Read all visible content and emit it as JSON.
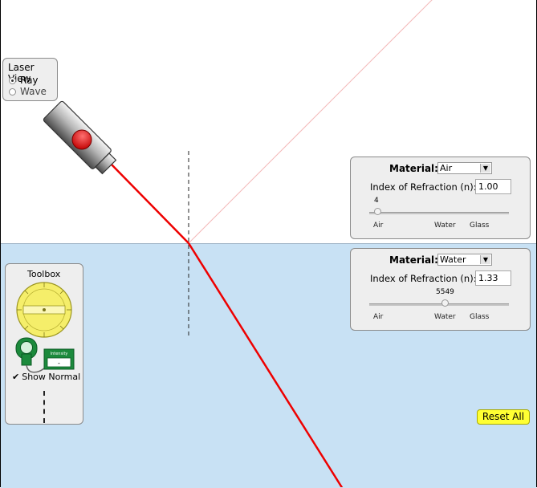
{
  "laser_view": {
    "title": "Laser View",
    "options": [
      {
        "label": "Ray",
        "selected": true
      },
      {
        "label": "Wave",
        "selected": false
      }
    ]
  },
  "top_material": {
    "label": "Material:",
    "selected": "Air",
    "ior_label": "Index of Refraction (n):",
    "ior_value": "1.00",
    "slider_value": "4",
    "slider_fraction": 0.05,
    "ticks": [
      "Air",
      "Water",
      "Glass"
    ]
  },
  "bottom_material": {
    "label": "Material:",
    "selected": "Water",
    "ior_label": "Index of Refraction (n):",
    "ior_value": "1.33",
    "slider_value": "5549",
    "slider_fraction": 0.55,
    "ticks": [
      "Air",
      "Water",
      "Glass"
    ]
  },
  "toolbox": {
    "title": "Toolbox",
    "intensity_label": "Intensity",
    "intensity_value": "-",
    "show_normal_label": "Show Normal",
    "show_normal_checked": true
  },
  "reset_label": "Reset All",
  "colors": {
    "water": "#c8e1f4",
    "laser": "#ee0000",
    "reflected": "#f3b8b8",
    "panel": "#eeeeee",
    "reset_button": "#ffff33",
    "protractor": "#f5ee6a"
  }
}
